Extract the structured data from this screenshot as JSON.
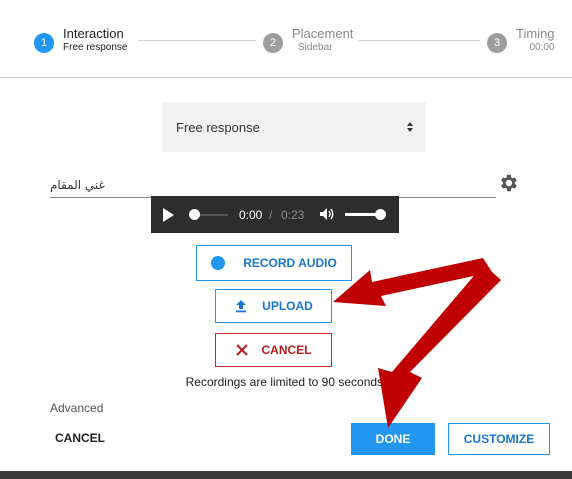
{
  "stepper": {
    "steps": [
      {
        "number": "1",
        "title": "Interaction",
        "subtitle": "Free response",
        "state": "active"
      },
      {
        "number": "2",
        "title": "Placement",
        "subtitle": "Sidebar",
        "state": "inactive"
      },
      {
        "number": "3",
        "title": "Timing",
        "subtitle": "00:00",
        "state": "inactive"
      }
    ]
  },
  "interaction_type": {
    "selected": "Free response"
  },
  "prompt_field": {
    "value": "غني المقام"
  },
  "player": {
    "current_time": "0:00",
    "separator": "/",
    "total_time": "0:23"
  },
  "buttons": {
    "record_audio": "RECORD AUDIO",
    "upload": "UPLOAD",
    "cancel_recording": "CANCEL"
  },
  "recording_limit": "Recordings are limited to 90 seconds.",
  "advanced_label": "Advanced",
  "footer": {
    "cancel": "CANCEL",
    "done": "DONE",
    "customize": "CUSTOMIZE"
  },
  "colors": {
    "accent": "#2196f3",
    "cancel_red": "#c62828",
    "annotation_arrow": "#c00000"
  }
}
